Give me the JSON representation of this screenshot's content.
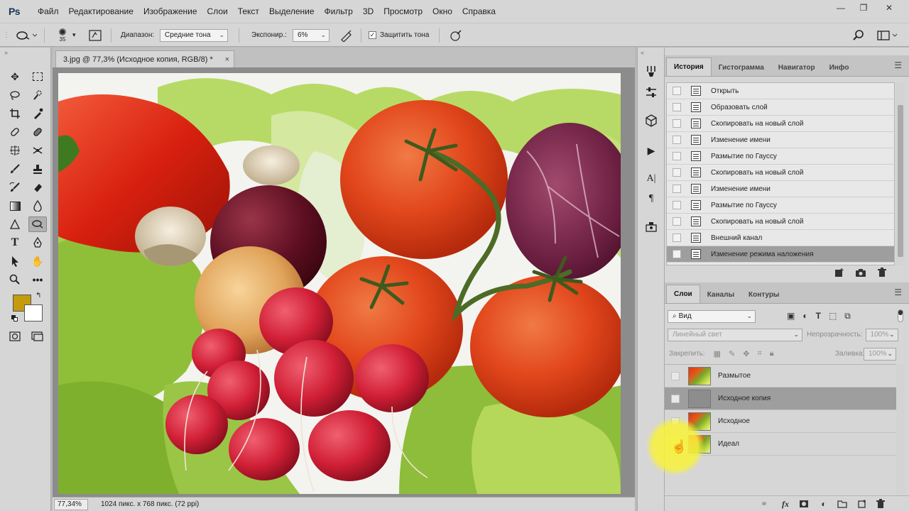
{
  "app": {
    "logo": "Ps",
    "menu": [
      "Файл",
      "Редактирование",
      "Изображение",
      "Слои",
      "Текст",
      "Выделение",
      "Фильтр",
      "3D",
      "Просмотр",
      "Окно",
      "Справка"
    ],
    "window_controls": {
      "minimize": "—",
      "restore": "❐",
      "close": "✕"
    }
  },
  "options": {
    "brush_size": "35",
    "range_label": "Диапазон:",
    "range_value": "Средние тона",
    "exposure_label": "Экспонир.:",
    "exposure_value": "6%",
    "protect_tones_label": "Защитить тона",
    "protect_tones_checked": true
  },
  "document": {
    "tab_title": "3.jpg @ 77,3% (Исходное копия, RGB/8) *",
    "close_glyph": "×",
    "zoom": "77,34%",
    "info": "1024 пикс. x 768 пикс. (72 ppi)"
  },
  "colors": {
    "foreground": "#c49b0c",
    "background": "#ffffff"
  },
  "history_panel": {
    "tabs": [
      "История",
      "Гистограмма",
      "Навигатор",
      "Инфо"
    ],
    "active_tab": "История",
    "items": [
      "Открыть",
      "Образовать слой",
      "Скопировать на новый слой",
      "Изменение имени",
      "Размытие по Гауссу",
      "Скопировать на новый слой",
      "Изменение имени",
      "Размытие по Гауссу",
      "Скопировать на новый слой",
      "Внешний канал",
      "Изменение режима наложения"
    ],
    "selected_index": 10
  },
  "layers_panel": {
    "tabs": [
      "Слои",
      "Каналы",
      "Контуры"
    ],
    "active_tab": "Слои",
    "filter_kind": "Вид",
    "blend_mode": "Линейный свет",
    "opacity_label": "Непрозрачность:",
    "opacity_value": "100%",
    "lock_label": "Закрепить:",
    "fill_label": "Заливка:",
    "fill_value": "100%",
    "layers": [
      {
        "name": "Размытое",
        "thumb": "veg",
        "selected": false
      },
      {
        "name": "Исходное копия",
        "thumb": "grey",
        "selected": true
      },
      {
        "name": "Исходное",
        "thumb": "veg",
        "selected": false
      },
      {
        "name": "Идеал",
        "thumb": "veg",
        "selected": false
      }
    ]
  }
}
